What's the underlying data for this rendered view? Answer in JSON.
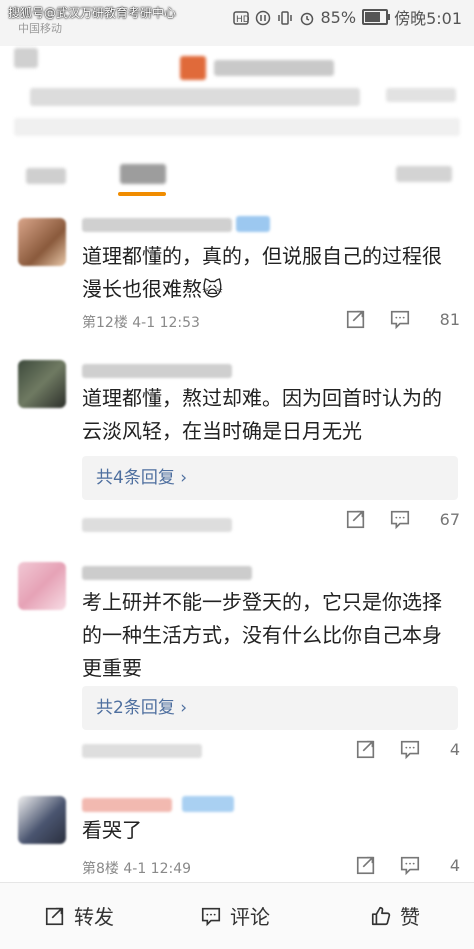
{
  "status_bar": {
    "watermark": "搜狐号@武汉万研教育考研中心",
    "carrier": "中国移动",
    "battery": "85%",
    "battery_fraction": 0.85,
    "time": "傍晚5:01"
  },
  "comments": [
    {
      "text": "道理都懂的，真的，但说服自己的过程很漫长也很难熬🙀",
      "floor_time": "第12楼  4-1 12:53",
      "likes": "81"
    },
    {
      "text": "道理都懂，熬过却难。因为回首时认为的云淡风轻，在当时确是日月无光",
      "replies": "共4条回复",
      "likes": "67"
    },
    {
      "text": "考上研并不能一步登天的，它只是你选择的一种生活方式，没有什么比你自己本身更重要",
      "replies": "共2条回复",
      "likes": "4"
    },
    {
      "text": "看哭了",
      "floor_time": "第8楼  4-1 12:49",
      "likes": "4"
    }
  ],
  "reply_chevron": "›",
  "icons": [
    "share-icon",
    "comment-icon",
    "like-icon"
  ],
  "bottom_bar": {
    "repost": "转发",
    "comment": "评论",
    "like": "赞"
  }
}
